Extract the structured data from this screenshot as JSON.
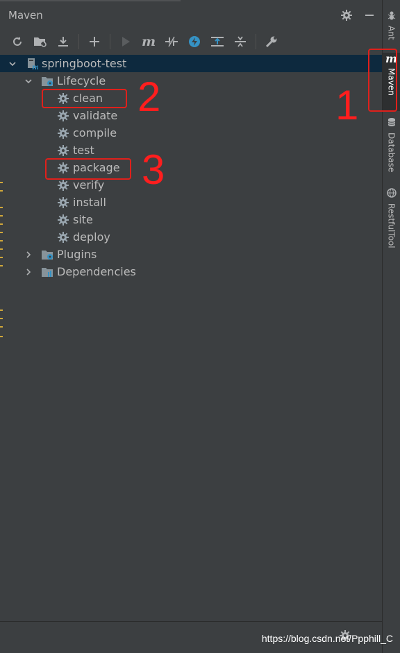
{
  "panel": {
    "title": "Maven"
  },
  "toolbar": {
    "icons": [
      "reload-icon",
      "add-project-icon",
      "download-icon",
      "plus-icon",
      "run-icon",
      "maven-m-icon",
      "toggle-offline-icon",
      "skip-tests-icon",
      "show-deps-icon",
      "collapse-icon",
      "settings-wrench-icon"
    ]
  },
  "tree": {
    "project": "springboot-test",
    "lifecycle": "Lifecycle",
    "goals": [
      "clean",
      "validate",
      "compile",
      "test",
      "package",
      "verify",
      "install",
      "site",
      "deploy"
    ],
    "plugins": "Plugins",
    "dependencies": "Dependencies"
  },
  "annotations": {
    "n1": "1",
    "n2": "2",
    "n3": "3"
  },
  "side_tabs": {
    "ant": "Ant",
    "maven": "Maven",
    "database": "Database",
    "restful": "RestfulTool"
  },
  "watermark": "https://blog.csdn.net/Ppphill_C",
  "colors": {
    "background": "#3c3f41",
    "selection": "#0d293e",
    "callout": "#e0201b",
    "gear": "#9aa7b0",
    "folder": "#87939a",
    "accent_blue": "#3592c4"
  }
}
